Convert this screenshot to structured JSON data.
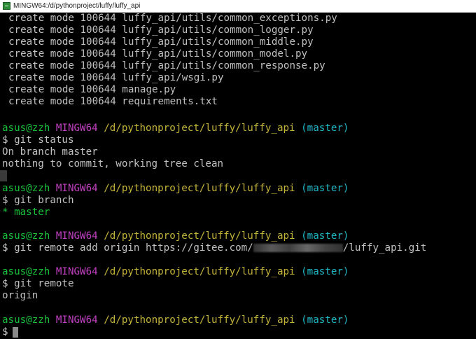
{
  "window": {
    "title": "MINGW64:/d/pythonproject/luffy/luffy_api"
  },
  "create_lines": [
    "create mode 100644 luffy_api/utils/common_exceptions.py",
    "create mode 100644 luffy_api/utils/common_logger.py",
    "create mode 100644 luffy_api/utils/common_middle.py",
    "create mode 100644 luffy_api/utils/common_model.py",
    "create mode 100644 luffy_api/utils/common_response.py",
    "create mode 100644 luffy_api/wsgi.py",
    "create mode 100644 manage.py",
    "create mode 100644 requirements.txt"
  ],
  "prompt": {
    "user": "asus@zzh",
    "host": "MINGW64",
    "path": "/d/pythonproject/luffy/luffy_api",
    "branch": "(master)",
    "symbol": "$"
  },
  "blocks": {
    "status": {
      "command": "git status",
      "output": [
        "On branch master",
        "nothing to commit, working tree clean"
      ]
    },
    "branch": {
      "command": "git branch",
      "output": "* master"
    },
    "remote_add": {
      "command_prefix": "git remote add origin https://gitee.com/",
      "command_suffix": "/luffy_api.git"
    },
    "remote": {
      "command": "git remote",
      "output": "origin"
    }
  },
  "colors": {
    "user": "#17c23a",
    "host": "#c040c0",
    "path": "#c3b43a",
    "branch": "#1fb7c4",
    "text": "#c0c0c0",
    "background": "#000000"
  }
}
